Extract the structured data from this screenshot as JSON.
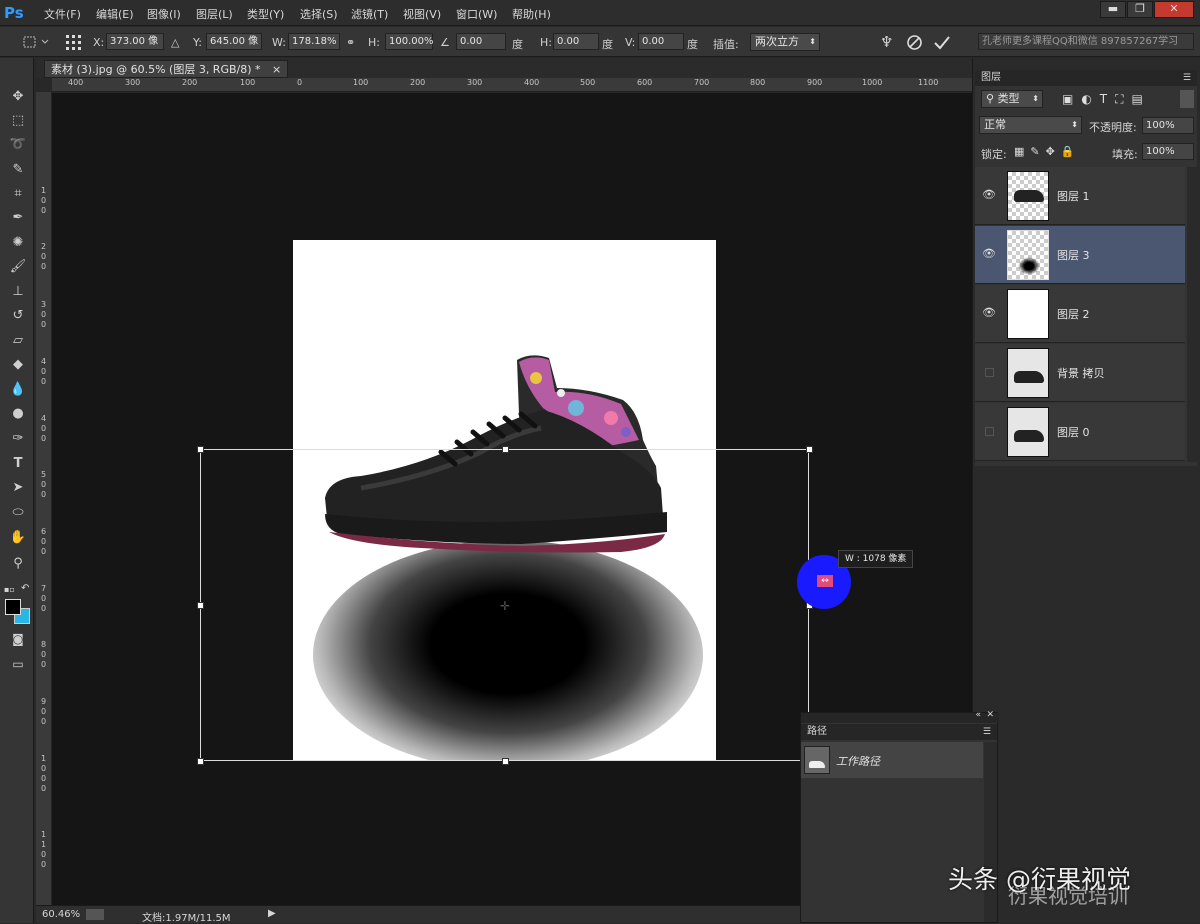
{
  "app": {
    "logo": "Ps"
  },
  "menu": [
    "文件(F)",
    "编辑(E)",
    "图像(I)",
    "图层(L)",
    "类型(Y)",
    "选择(S)",
    "滤镜(T)",
    "视图(V)",
    "窗口(W)",
    "帮助(H)"
  ],
  "window_buttons": {
    "minimize": "▬",
    "restore": "❐",
    "close": "✕"
  },
  "options": {
    "x_label": "X:",
    "x_value": "373.00 像",
    "y_label": "Y:",
    "y_value": "645.00 像",
    "w_label": "W:",
    "w_value": "178.18%",
    "h_label": "H:",
    "h_value": "100.00%",
    "angle_value": "0.00",
    "angle_unit": "度",
    "hskew_label": "H:",
    "hskew_value": "0.00",
    "vskew_label": "V:",
    "vskew_value": "0.00",
    "interp_label": "插值:",
    "interp_value": "两次立方",
    "notice": "孔老师更多课程QQ和微信 897857267学习"
  },
  "document": {
    "tab_title": "素材 (3).jpg @ 60.5% (图层 3, RGB/8) *",
    "tab_close": "×"
  },
  "ruler_top_labels": [
    "400",
    "300",
    "200",
    "100",
    "0",
    "100",
    "200",
    "300",
    "400",
    "500",
    "600",
    "700",
    "800",
    "900",
    "1000",
    "1100"
  ],
  "ruler_left_labels": [
    "1\n0\n0",
    "2\n0\n0",
    "3\n0\n0",
    "4\n0\n0",
    "5\n0\n0",
    "6\n0\n0",
    "7\n0\n0",
    "8\n0\n0",
    "9\n0\n0",
    "1\n0\n0\n0",
    "1\n1\n0\n0"
  ],
  "tooltip": "W : 1078 像素",
  "status": {
    "zoom": "60.46%",
    "doc_info": "文档:1.97M/11.5M"
  },
  "layers_panel": {
    "title": "图层",
    "filter_kind": "类型",
    "blend_mode": "正常",
    "opacity_label": "不透明度:",
    "opacity_value": "100%",
    "lock_label": "锁定:",
    "fill_label": "填充:",
    "fill_value": "100%",
    "layers": [
      {
        "name": "图层 1",
        "visible": true,
        "selected": false,
        "thumb": "shoe-checker"
      },
      {
        "name": "图层 3",
        "visible": true,
        "selected": true,
        "thumb": "shadow-checker"
      },
      {
        "name": "图层 2",
        "visible": true,
        "selected": false,
        "thumb": "white"
      },
      {
        "name": "背景 拷贝",
        "visible": false,
        "selected": false,
        "thumb": "shoe"
      },
      {
        "name": "图层 0",
        "visible": false,
        "selected": false,
        "thumb": "shoe"
      }
    ]
  },
  "paths_panel": {
    "title": "路径",
    "items": [
      {
        "name": "工作路径"
      }
    ]
  },
  "watermark": {
    "line1": "头条 @衍果视觉",
    "line2": "衍果视觉培训"
  }
}
